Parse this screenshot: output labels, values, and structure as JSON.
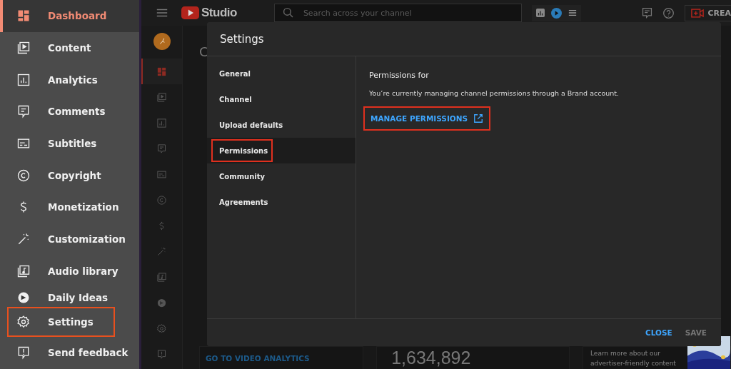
{
  "sidebar": {
    "items": [
      {
        "label": "Dashboard",
        "selected": true,
        "highlighted": false
      },
      {
        "label": "Content",
        "selected": false,
        "highlighted": false
      },
      {
        "label": "Analytics",
        "selected": false,
        "highlighted": false
      },
      {
        "label": "Comments",
        "selected": false,
        "highlighted": false
      },
      {
        "label": "Subtitles",
        "selected": false,
        "highlighted": false
      },
      {
        "label": "Copyright",
        "selected": false,
        "highlighted": false
      },
      {
        "label": "Monetization",
        "selected": false,
        "highlighted": false
      },
      {
        "label": "Customization",
        "selected": false,
        "highlighted": false
      },
      {
        "label": "Audio library",
        "selected": false,
        "highlighted": false
      },
      {
        "label": "Daily Ideas",
        "selected": false,
        "highlighted": false
      },
      {
        "label": "Settings",
        "selected": false,
        "highlighted": true
      },
      {
        "label": "Send feedback",
        "selected": false,
        "highlighted": false
      }
    ]
  },
  "topbar": {
    "logo_text": "Studio",
    "search": {
      "placeholder": "Search across your channel"
    },
    "create_button": "CREA"
  },
  "page": {
    "title_fragment": "C",
    "analytics_link": "GO TO VIDEO ANALYTICS",
    "big_number": "1,634,892",
    "promo_text": "Learn more about our advertiser-friendly content"
  },
  "dialog": {
    "title": "Settings",
    "nav": [
      {
        "label": "General",
        "selected": false,
        "highlighted": false
      },
      {
        "label": "Channel",
        "selected": false,
        "highlighted": false
      },
      {
        "label": "Upload defaults",
        "selected": false,
        "highlighted": false
      },
      {
        "label": "Permissions",
        "selected": true,
        "highlighted": true
      },
      {
        "label": "Community",
        "selected": false,
        "highlighted": false
      },
      {
        "label": "Agreements",
        "selected": false,
        "highlighted": false
      }
    ],
    "heading": "Permissions for",
    "description": "You’re currently managing channel permissions through a Brand account.",
    "manage_button": {
      "label": "MANAGE PERMISSIONS",
      "highlighted": true
    },
    "buttons": [
      {
        "label": "CLOSE",
        "disabled": false
      },
      {
        "label": "SAVE",
        "disabled": true
      }
    ]
  }
}
